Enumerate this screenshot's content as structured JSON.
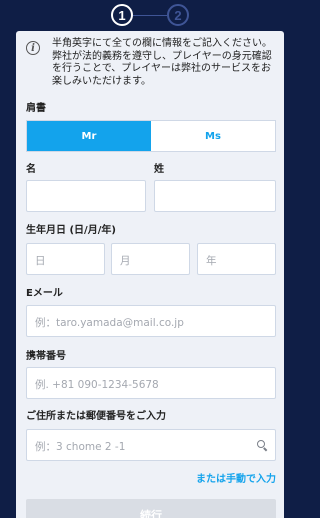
{
  "stepper": {
    "step1": "1",
    "step2": "2"
  },
  "info": {
    "icon": "info-icon",
    "text": "半角英字にて全ての欄に情報をご記入ください。弊社が法的義務を遵守し、プレイヤーの身元確認を行うことで、プレイヤーは弊社のサービスをお楽しみいただけます。"
  },
  "title_field": {
    "label": "肩書",
    "mr": "Mr",
    "ms": "Ms",
    "selected": "Mr"
  },
  "first_name": {
    "label": "名",
    "value": ""
  },
  "last_name": {
    "label": "姓",
    "value": ""
  },
  "dob": {
    "label": "生年月日 (日/月/年)",
    "day_placeholder": "日",
    "month_placeholder": "月",
    "year_placeholder": "年"
  },
  "email": {
    "label": "Eメール",
    "placeholder": "例：taro.yamada@mail.co.jp"
  },
  "phone": {
    "label": "携帯番号",
    "placeholder": "例. +81 090-1234-5678"
  },
  "address": {
    "label": "ご住所または郵便番号をご入力",
    "placeholder": "例：3 chome 2 -1",
    "search_icon": "search-icon"
  },
  "manual_entry": "または手動で入力",
  "continue_button": "続行",
  "colors": {
    "background": "#0f1e46",
    "accent": "#13a3ec",
    "card": "#eef1f7",
    "button_disabled": "#d9dde4"
  }
}
